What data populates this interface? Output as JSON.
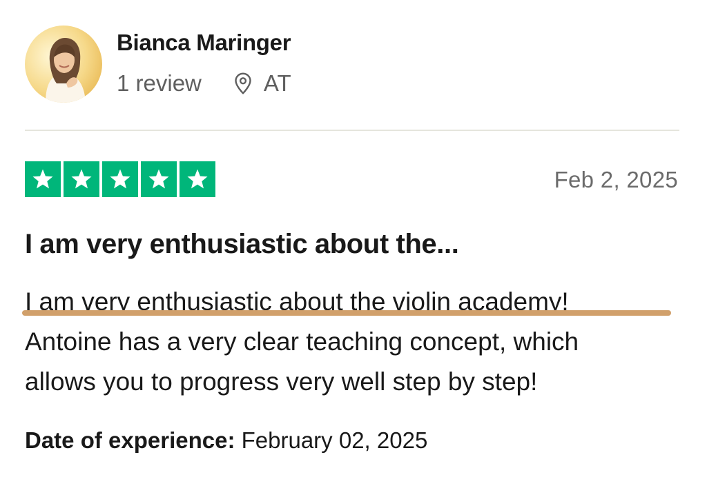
{
  "reviewer": {
    "name": "Bianca Maringer",
    "review_count": "1 review",
    "location": "AT",
    "avatar_icon": "profile-photo"
  },
  "rating": {
    "stars": 5,
    "max_stars": 5,
    "star_color": "#00b67a",
    "star_icon": "star-icon"
  },
  "review": {
    "date": "Feb 2, 2025",
    "title": "I am very enthusiastic about the...",
    "body_lines": [
      "I am very enthusiastic about the violin academy!",
      "Antoine has a very clear teaching concept, which",
      "allows you to progress very well step by step!"
    ],
    "highlight_color": "#d1a06b"
  },
  "experience": {
    "label": "Date of experience:",
    "value": "February 02, 2025"
  }
}
